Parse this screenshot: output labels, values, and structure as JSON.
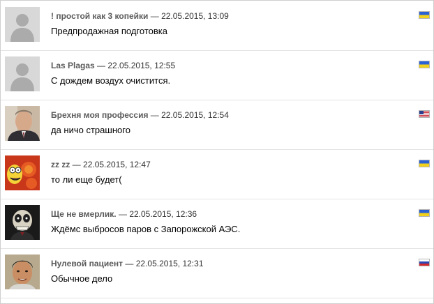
{
  "comments": [
    {
      "author": "! простой как 3 копейки",
      "sep": " — ",
      "datetime": "22.05.2015, 13:09",
      "text": "Предпродажная подготовка",
      "avatar": "default-user-icon",
      "flag": "ukraine-flag-icon"
    },
    {
      "author": "Las Plagas",
      "sep": " — ",
      "datetime": "22.05.2015, 12:55",
      "text": "С дождем воздух очистится.",
      "avatar": "default-user-icon",
      "flag": "ukraine-flag-icon"
    },
    {
      "author": "Брехня моя профессия",
      "sep": " — ",
      "datetime": "22.05.2015, 12:54",
      "text": "да ничо страшного",
      "avatar": "man-portrait-photo",
      "flag": "usa-flag-icon"
    },
    {
      "author": "zz zz",
      "sep": " — ",
      "datetime": "22.05.2015, 12:47",
      "text": "то ли еще будет(",
      "avatar": "cartoon-character-picture",
      "flag": "ukraine-flag-icon"
    },
    {
      "author": "Ще не вмерлик.",
      "sep": " — ",
      "datetime": "22.05.2015, 12:36",
      "text": "Ждёмс выбросов паров с Запорожской АЭС.",
      "avatar": "skull-puppet-picture",
      "flag": "ukraine-flag-icon"
    },
    {
      "author": "Нулевой пациент",
      "sep": " — ",
      "datetime": "22.05.2015, 12:31",
      "text": "Обычное дело",
      "avatar": "young-man-photo",
      "flag": "russia-flag-icon"
    }
  ]
}
